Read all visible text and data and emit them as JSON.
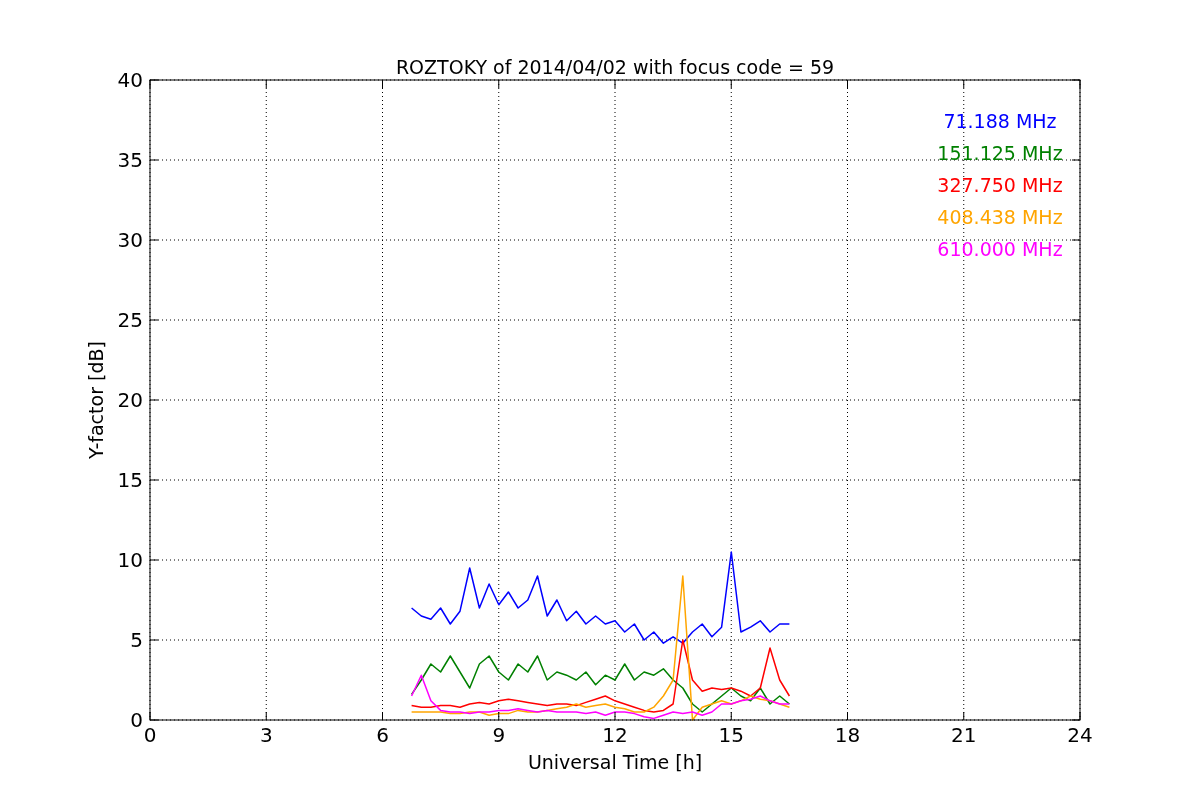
{
  "chart_data": {
    "type": "line",
    "title": "ROZTOKY of 2014/04/02 with focus code = 59",
    "xlabel": "Universal Time [h]",
    "ylabel": "Y-factor [dB]",
    "x": [
      6.75,
      7,
      7.25,
      7.5,
      7.75,
      8,
      8.25,
      8.5,
      8.75,
      9,
      9.25,
      9.5,
      9.75,
      10,
      10.25,
      10.5,
      10.75,
      11,
      11.25,
      11.5,
      11.75,
      12,
      12.25,
      12.5,
      12.75,
      13,
      13.25,
      13.5,
      13.75,
      14,
      14.25,
      14.5,
      14.75,
      15,
      15.25,
      15.5,
      15.75,
      16,
      16.25,
      16.5
    ],
    "series": [
      {
        "name": "71.188 MHz",
        "color": "#0000ff",
        "values": [
          7.0,
          6.5,
          6.3,
          7.0,
          6.0,
          6.8,
          9.5,
          7.0,
          8.5,
          7.2,
          8.0,
          7.0,
          7.5,
          9.0,
          6.5,
          7.5,
          6.2,
          6.8,
          6.0,
          6.5,
          6.0,
          6.2,
          5.5,
          6.0,
          5.0,
          5.5,
          4.8,
          5.2,
          4.8,
          5.5,
          6.0,
          5.2,
          5.8,
          10.5,
          5.5,
          5.8,
          6.2,
          5.5,
          6.0,
          6.0
        ]
      },
      {
        "name": "151.125 MHz",
        "color": "#008000",
        "values": [
          1.6,
          2.5,
          3.5,
          3.0,
          4.0,
          3.0,
          2.0,
          3.5,
          4.0,
          3.0,
          2.5,
          3.5,
          3.0,
          4.0,
          2.5,
          3.0,
          2.8,
          2.5,
          3.0,
          2.2,
          2.8,
          2.5,
          3.5,
          2.5,
          3.0,
          2.8,
          3.2,
          2.5,
          2.0,
          1.0,
          0.5,
          1.0,
          1.5,
          2.0,
          1.5,
          1.2,
          2.0,
          1.0,
          1.5,
          1.0
        ]
      },
      {
        "name": "327.750 MHz",
        "color": "#ff0000",
        "values": [
          0.9,
          0.8,
          0.8,
          0.9,
          0.9,
          0.8,
          1.0,
          1.1,
          1.0,
          1.2,
          1.3,
          1.2,
          1.1,
          1.0,
          0.9,
          1.0,
          1.0,
          0.9,
          1.1,
          1.3,
          1.5,
          1.2,
          1.0,
          0.8,
          0.6,
          0.5,
          0.6,
          1.0,
          5.0,
          2.5,
          1.8,
          2.0,
          1.9,
          2.0,
          1.8,
          1.5,
          2.0,
          4.5,
          2.5,
          1.5
        ]
      },
      {
        "name": "408.438 MHz",
        "color": "#ffa500",
        "values": [
          0.5,
          0.5,
          0.5,
          0.5,
          0.4,
          0.4,
          0.5,
          0.5,
          0.3,
          0.4,
          0.4,
          0.6,
          0.5,
          0.5,
          0.6,
          0.7,
          0.8,
          1.0,
          0.8,
          0.9,
          1.0,
          0.8,
          0.7,
          0.5,
          0.5,
          0.8,
          1.5,
          2.5,
          9.0,
          0.0,
          0.8,
          1.0,
          1.2,
          1.0,
          1.2,
          1.5,
          1.3,
          1.2,
          1.0,
          0.8
        ]
      },
      {
        "name": "610.000 MHz",
        "color": "#ff00ff",
        "values": [
          1.5,
          2.8,
          1.2,
          0.6,
          0.5,
          0.5,
          0.4,
          0.5,
          0.5,
          0.6,
          0.6,
          0.7,
          0.6,
          0.5,
          0.6,
          0.5,
          0.5,
          0.5,
          0.4,
          0.5,
          0.3,
          0.5,
          0.5,
          0.4,
          0.2,
          0.1,
          0.3,
          0.5,
          0.4,
          0.5,
          0.3,
          0.5,
          1.0,
          1.0,
          1.2,
          1.3,
          1.5,
          1.2,
          1.0,
          1.0
        ]
      }
    ],
    "grid": true,
    "xlim": [
      0,
      24
    ],
    "ylim": [
      0,
      40
    ],
    "xticks": [
      0,
      3,
      6,
      9,
      12,
      15,
      18,
      21,
      24
    ],
    "yticks": [
      0,
      5,
      10,
      15,
      20,
      25,
      30,
      35,
      40
    ]
  }
}
